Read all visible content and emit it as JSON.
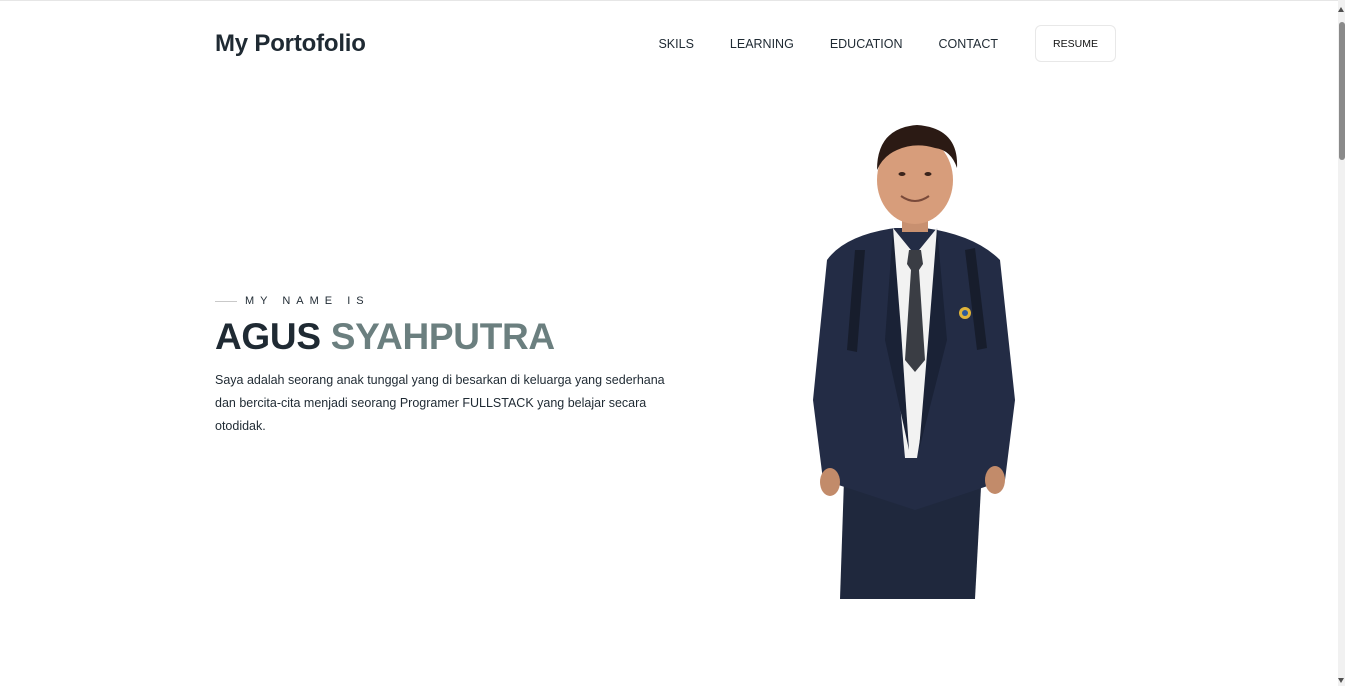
{
  "header": {
    "brand": "My Portofolio",
    "nav": [
      "SKILS",
      "LEARNING",
      "EDUCATION",
      "CONTACT"
    ],
    "resume_label": "RESUME"
  },
  "hero": {
    "eyebrow": "MY NAME IS",
    "first_name": "AGUS",
    "last_name": "SYAHPUTRA",
    "bio": "Saya adalah seorang anak tunggal yang di besarkan di keluarga yang sederhana dan bercita-cita menjadi seorang Programer FULLSTACK yang belajar secara otodidak."
  },
  "colors": {
    "text": "#1f2a33",
    "accent": "#6b7f7f",
    "suit": "#232c45"
  }
}
